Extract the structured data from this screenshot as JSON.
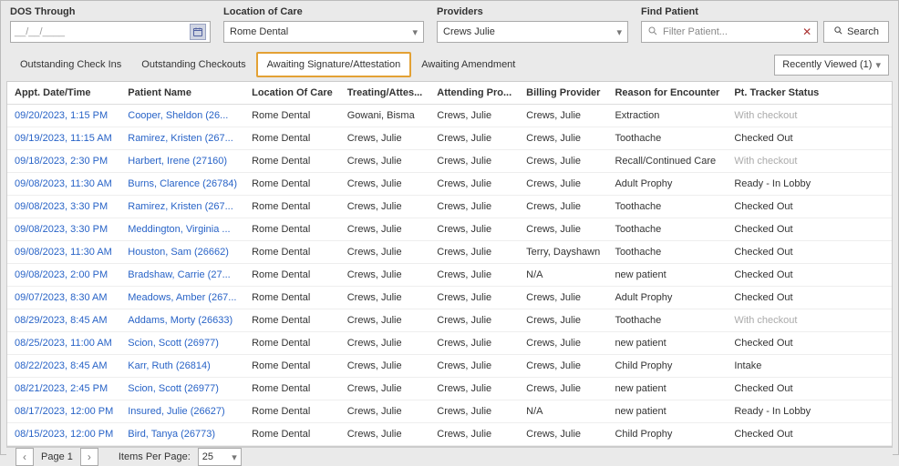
{
  "filters": {
    "dos_label": "DOS Through",
    "dos_value": "__/__/____",
    "loc_label": "Location of Care",
    "loc_value": "Rome Dental",
    "prov_label": "Providers",
    "prov_value": "Crews Julie",
    "find_label": "Find Patient",
    "find_placeholder": "Filter Patient...",
    "search_label": "Search"
  },
  "tabs": {
    "t1": "Outstanding Check Ins",
    "t2": "Outstanding Checkouts",
    "t3": "Awaiting Signature/Attestation",
    "t4": "Awaiting Amendment"
  },
  "recently": {
    "label": "Recently Viewed (1)"
  },
  "columns": {
    "c1": "Appt. Date/Time",
    "c2": "Patient Name",
    "c3": "Location Of Care",
    "c4": "Treating/Attes...",
    "c5": "Attending Pro...",
    "c6": "Billing Provider",
    "c7": "Reason for Encounter",
    "c8": "Pt. Tracker Status"
  },
  "rows": [
    {
      "dt": "09/20/2023, 1:15 PM",
      "pn": "Cooper, Sheldon (26...",
      "loc": "Rome Dental",
      "ta": "Gowani, Bisma",
      "ap": "Crews, Julie",
      "bp": "Crews, Julie",
      "re": "Extraction",
      "st": "With checkout",
      "muted": true
    },
    {
      "dt": "09/19/2023, 11:15 AM",
      "pn": "Ramirez, Kristen (267...",
      "loc": "Rome Dental",
      "ta": "Crews, Julie",
      "ap": "Crews, Julie",
      "bp": "Crews, Julie",
      "re": "Toothache",
      "st": "Checked Out"
    },
    {
      "dt": "09/18/2023, 2:30 PM",
      "pn": "Harbert, Irene (27160)",
      "loc": "Rome Dental",
      "ta": "Crews, Julie",
      "ap": "Crews, Julie",
      "bp": "Crews, Julie",
      "re": "Recall/Continued Care",
      "st": "With checkout",
      "muted": true
    },
    {
      "dt": "09/08/2023, 11:30 AM",
      "pn": "Burns, Clarence (26784)",
      "loc": "Rome Dental",
      "ta": "Crews, Julie",
      "ap": "Crews, Julie",
      "bp": "Crews, Julie",
      "re": "Adult Prophy",
      "st": "Ready - In Lobby"
    },
    {
      "dt": "09/08/2023, 3:30 PM",
      "pn": "Ramirez, Kristen (267...",
      "loc": "Rome Dental",
      "ta": "Crews, Julie",
      "ap": "Crews, Julie",
      "bp": "Crews, Julie",
      "re": "Toothache",
      "st": "Checked Out"
    },
    {
      "dt": "09/08/2023, 3:30 PM",
      "pn": "Meddington, Virginia ...",
      "loc": "Rome Dental",
      "ta": "Crews, Julie",
      "ap": "Crews, Julie",
      "bp": "Crews, Julie",
      "re": "Toothache",
      "st": "Checked Out"
    },
    {
      "dt": "09/08/2023, 11:30 AM",
      "pn": "Houston, Sam (26662)",
      "loc": "Rome Dental",
      "ta": "Crews, Julie",
      "ap": "Crews, Julie",
      "bp": "Terry, Dayshawn",
      "re": "Toothache",
      "st": "Checked Out"
    },
    {
      "dt": "09/08/2023, 2:00 PM",
      "pn": "Bradshaw, Carrie (27...",
      "loc": "Rome Dental",
      "ta": "Crews, Julie",
      "ap": "Crews, Julie",
      "bp": "N/A",
      "re": "new patient",
      "st": "Checked Out"
    },
    {
      "dt": "09/07/2023, 8:30 AM",
      "pn": "Meadows, Amber (267...",
      "loc": "Rome Dental",
      "ta": "Crews, Julie",
      "ap": "Crews, Julie",
      "bp": "Crews, Julie",
      "re": "Adult Prophy",
      "st": "Checked Out"
    },
    {
      "dt": "08/29/2023, 8:45 AM",
      "pn": "Addams, Morty (26633)",
      "loc": "Rome Dental",
      "ta": "Crews, Julie",
      "ap": "Crews, Julie",
      "bp": "Crews, Julie",
      "re": "Toothache",
      "st": "With checkout",
      "muted": true
    },
    {
      "dt": "08/25/2023, 11:00 AM",
      "pn": "Scion, Scott (26977)",
      "loc": "Rome Dental",
      "ta": "Crews, Julie",
      "ap": "Crews, Julie",
      "bp": "Crews, Julie",
      "re": "new patient",
      "st": "Checked Out"
    },
    {
      "dt": "08/22/2023, 8:45 AM",
      "pn": "Karr, Ruth (26814)",
      "loc": "Rome Dental",
      "ta": "Crews, Julie",
      "ap": "Crews, Julie",
      "bp": "Crews, Julie",
      "re": "Child Prophy",
      "st": "Intake"
    },
    {
      "dt": "08/21/2023, 2:45 PM",
      "pn": "Scion, Scott (26977)",
      "loc": "Rome Dental",
      "ta": "Crews, Julie",
      "ap": "Crews, Julie",
      "bp": "Crews, Julie",
      "re": "new patient",
      "st": "Checked Out"
    },
    {
      "dt": "08/17/2023, 12:00 PM",
      "pn": "Insured, Julie (26627)",
      "loc": "Rome Dental",
      "ta": "Crews, Julie",
      "ap": "Crews, Julie",
      "bp": "N/A",
      "re": "new patient",
      "st": "Ready - In Lobby"
    },
    {
      "dt": "08/15/2023, 12:00 PM",
      "pn": "Bird, Tanya (26773)",
      "loc": "Rome Dental",
      "ta": "Crews, Julie",
      "ap": "Crews, Julie",
      "bp": "Crews, Julie",
      "re": "Child Prophy",
      "st": "Checked Out"
    }
  ],
  "footer": {
    "page_label": "Page 1",
    "ipp_label": "Items Per Page:",
    "ipp_value": "25"
  }
}
